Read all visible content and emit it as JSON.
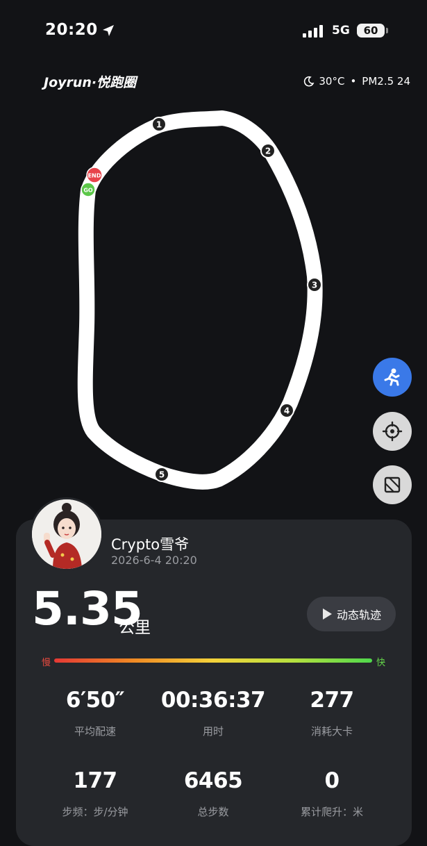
{
  "status_bar": {
    "time": "20:20",
    "network": "5G",
    "battery": "60"
  },
  "header": {
    "logo": "Joyrun·悦跑圈",
    "weather": {
      "temperature": "30°C",
      "separator": "•",
      "air_quality": "PM2.5 24"
    }
  },
  "map": {
    "route_color": "#ffffff",
    "start_label": "GO",
    "end_label": "END",
    "km_markers": [
      "1",
      "2",
      "3",
      "4",
      "5"
    ]
  },
  "map_buttons": [
    {
      "name": "run-mode-button",
      "icon": "runner-icon"
    },
    {
      "name": "locate-button",
      "icon": "crosshair-icon"
    },
    {
      "name": "image-button",
      "icon": "image-icon"
    }
  ],
  "card": {
    "username": "Crypto雪爷",
    "datetime": "2026-6-4 20:20",
    "distance": "5.35",
    "distance_unit": "公里",
    "playback_label": "动态轨迹",
    "pace_scale": {
      "slow": "慢",
      "fast": "快"
    },
    "stats": [
      {
        "value": "6′50″",
        "label": "平均配速"
      },
      {
        "value": "00:36:37",
        "label": "用时"
      },
      {
        "value": "277",
        "label": "消耗大卡"
      },
      {
        "value": "177",
        "label": "步频：步/分钟"
      },
      {
        "value": "6465",
        "label": "总步数"
      },
      {
        "value": "0",
        "label": "累计爬升：米"
      }
    ]
  },
  "colors": {
    "background": "#121316",
    "card": "#25272b",
    "accent_blue": "#3a79e8",
    "end_red": "#e8434b",
    "go_green": "#5cc749"
  }
}
